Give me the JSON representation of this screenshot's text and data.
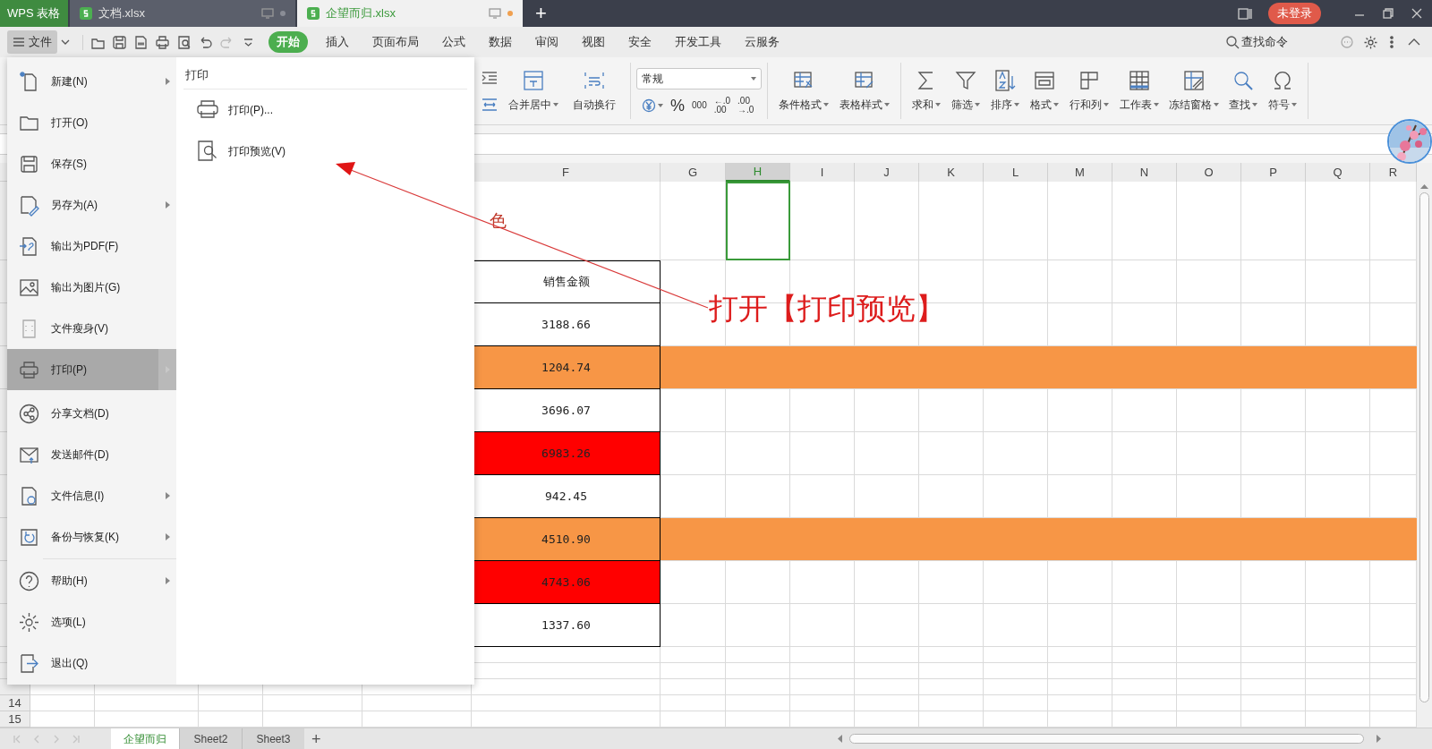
{
  "title_bar": {
    "app_name": "WPS 表格",
    "tabs": [
      {
        "label": "文档.xlsx",
        "selected": false
      },
      {
        "label": "企望而归.xlsx",
        "selected": true
      }
    ],
    "new_tab": "+",
    "login_button": "未登录"
  },
  "menu_bar": {
    "file_button": "文件",
    "tabs": [
      {
        "label": "开始",
        "selected": true
      },
      {
        "label": "插入",
        "selected": false
      },
      {
        "label": "页面布局",
        "selected": false
      },
      {
        "label": "公式",
        "selected": false
      },
      {
        "label": "数据",
        "selected": false
      },
      {
        "label": "审阅",
        "selected": false
      },
      {
        "label": "视图",
        "selected": false
      },
      {
        "label": "安全",
        "selected": false
      },
      {
        "label": "开发工具",
        "selected": false
      },
      {
        "label": "云服务",
        "selected": false
      }
    ],
    "search": "查找命令"
  },
  "ribbon": {
    "alignment": [
      {
        "label": "合并居中",
        "dropdown": true
      },
      {
        "label": "自动换行",
        "dropdown": false
      }
    ],
    "number_format": "常规",
    "percent": "%",
    "thousands": "000",
    "decimals": [
      "←.0",
      ".00",
      ".00",
      "→.0"
    ],
    "styles": [
      {
        "label": "条件格式",
        "dropdown": true
      },
      {
        "label": "表格样式",
        "dropdown": true
      }
    ],
    "tools": [
      {
        "label": "求和",
        "dropdown": true
      },
      {
        "label": "筛选",
        "dropdown": true
      },
      {
        "label": "排序",
        "dropdown": true
      },
      {
        "label": "格式",
        "dropdown": true
      },
      {
        "label": "行和列",
        "dropdown": true
      },
      {
        "label": "工作表",
        "dropdown": true
      },
      {
        "label": "冻结窗格",
        "dropdown": true
      },
      {
        "label": "查找",
        "dropdown": true
      },
      {
        "label": "符号",
        "dropdown": true
      }
    ]
  },
  "file_menu": {
    "items": [
      {
        "label": "新建(N)",
        "submenu": true,
        "selected": false
      },
      {
        "label": "打开(O)",
        "submenu": false,
        "selected": false
      },
      {
        "label": "保存(S)",
        "submenu": false,
        "selected": false
      },
      {
        "label": "另存为(A)",
        "submenu": true,
        "selected": false
      },
      {
        "label": "输出为PDF(F)",
        "submenu": false,
        "selected": false
      },
      {
        "label": "输出为图片(G)",
        "submenu": false,
        "selected": false
      },
      {
        "label": "文件瘦身(V)",
        "submenu": false,
        "selected": false
      },
      {
        "label": "打印(P)",
        "submenu": true,
        "selected": true
      },
      {
        "label": "分享文档(D)",
        "submenu": false,
        "selected": false
      },
      {
        "label": "发送邮件(D)",
        "submenu": false,
        "selected": false
      },
      {
        "label": "文件信息(I)",
        "submenu": true,
        "selected": false
      },
      {
        "label": "备份与恢复(K)",
        "submenu": true,
        "selected": false
      },
      {
        "label": "帮助(H)",
        "submenu": true,
        "selected": false
      },
      {
        "label": "选项(L)",
        "submenu": false,
        "selected": false
      },
      {
        "label": "退出(Q)",
        "submenu": false,
        "selected": false
      }
    ],
    "panel": {
      "title": "打印",
      "items": [
        "打印(P)...",
        "打印预览(V)"
      ]
    }
  },
  "sheet": {
    "columns": [
      {
        "label": "F",
        "selected": false
      },
      {
        "label": "G",
        "selected": false
      },
      {
        "label": "H",
        "selected": true
      },
      {
        "label": "I",
        "selected": false
      },
      {
        "label": "J",
        "selected": false
      },
      {
        "label": "K",
        "selected": false
      },
      {
        "label": "L",
        "selected": false
      },
      {
        "label": "M",
        "selected": false
      },
      {
        "label": "N",
        "selected": false
      },
      {
        "label": "O",
        "selected": false
      },
      {
        "label": "P",
        "selected": false
      },
      {
        "label": "Q",
        "selected": false
      },
      {
        "label": "R",
        "selected": false
      }
    ],
    "title_fragment": "色",
    "rows": [
      {
        "value": "销售金额",
        "kind": "plain"
      },
      {
        "value": "3188.66",
        "kind": "plain"
      },
      {
        "value": "1204.74",
        "kind": "band",
        "color": "#f79646"
      },
      {
        "value": "3696.07",
        "kind": "plain"
      },
      {
        "value": "6983.26",
        "kind": "filled",
        "color": "#ff0000"
      },
      {
        "value": "942.45",
        "kind": "plain"
      },
      {
        "value": "4510.90",
        "kind": "band",
        "color": "#f79646"
      },
      {
        "value": "4743.06",
        "kind": "filled",
        "color": "#ff0000"
      },
      {
        "value": "1337.60",
        "kind": "plain"
      }
    ],
    "row_labels": [
      "14",
      "15"
    ]
  },
  "annotation": {
    "text": "打开【打印预览】"
  },
  "sheet_tabs": [
    {
      "label": "企望而归",
      "selected": true
    },
    {
      "label": "Sheet2",
      "selected": false
    },
    {
      "label": "Sheet3",
      "selected": false
    }
  ],
  "add_sheet": "+"
}
